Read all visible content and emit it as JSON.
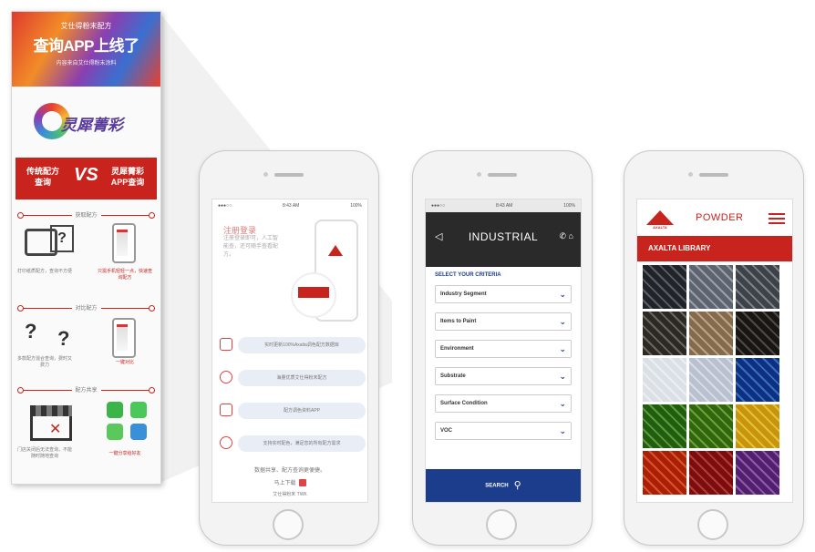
{
  "banner": {
    "hero_line1": "艾仕得粉末配方",
    "hero_line2": "查询APP上线了",
    "hero_line3": "内容来自艾仕得粉末涂料",
    "logo_text": "灵犀菁彩",
    "compare_left": "传统配方查询",
    "compare_vs": "VS",
    "compare_right": "灵犀菁彩APP查询",
    "section1": "获取配方",
    "section2": "对比配方",
    "section3": "配方共享",
    "caption1": "打印纸质配方，查询不方便",
    "caption1_red": "只需手机轻轻一点，快速查询配方",
    "caption2": "多款配方混合查询，费时又费力",
    "caption2_red": "一键对比",
    "caption3": "门店关闭后无法查询，不能随时随地查询",
    "caption3_red": "一键分享给好友"
  },
  "phone1": {
    "status_left": "●●●○○ ",
    "status_time": "8:43 AM",
    "status_right": "100%",
    "intro_big": "注册登录",
    "intro_text": "注册登录即可，人工智能查，还可随手查看配方。",
    "options": [
      "实时更新100%Axalta调色配方数据库",
      "海量优质艾仕得粉末配方",
      "配方调色资料APP",
      "支持实时配色，满足您的所有配方需求"
    ],
    "footer1": "数据共享、配方查询更便捷。",
    "footer2": "马上下载",
    "footer3": "艾仕得粉末 TWK"
  },
  "phone2": {
    "status_left": "●●●○○ ",
    "status_time": "8:43 AM",
    "status_right": "100%",
    "back": "◁",
    "title": "INDUSTRIAL",
    "icons": "✆ ⌂",
    "criteria_label": "SELECT YOUR CRITERIA",
    "selects": [
      "Industry Segment",
      "Items to Paint",
      "Environment",
      "Substrate",
      "Surface Condition",
      "VOC"
    ],
    "search_label": "SEARCH",
    "search_icon": "magnifier-icon"
  },
  "phone3": {
    "logo_text": "AXALTA",
    "title": "POWDER",
    "library_label": "AXALTA LIBRARY",
    "swatch_colors": [
      "#5a5f66",
      "#9aa0a8",
      "#7d8288",
      "#6a655e",
      "#b8a48a",
      "#4f4a46",
      "#eceff2",
      "#d9dee6",
      "#3a6fb8",
      "#5b9a3c",
      "#6fa13a",
      "#e2c23a",
      "#d2572a",
      "#b23a3a",
      "#8f5aa8"
    ]
  }
}
